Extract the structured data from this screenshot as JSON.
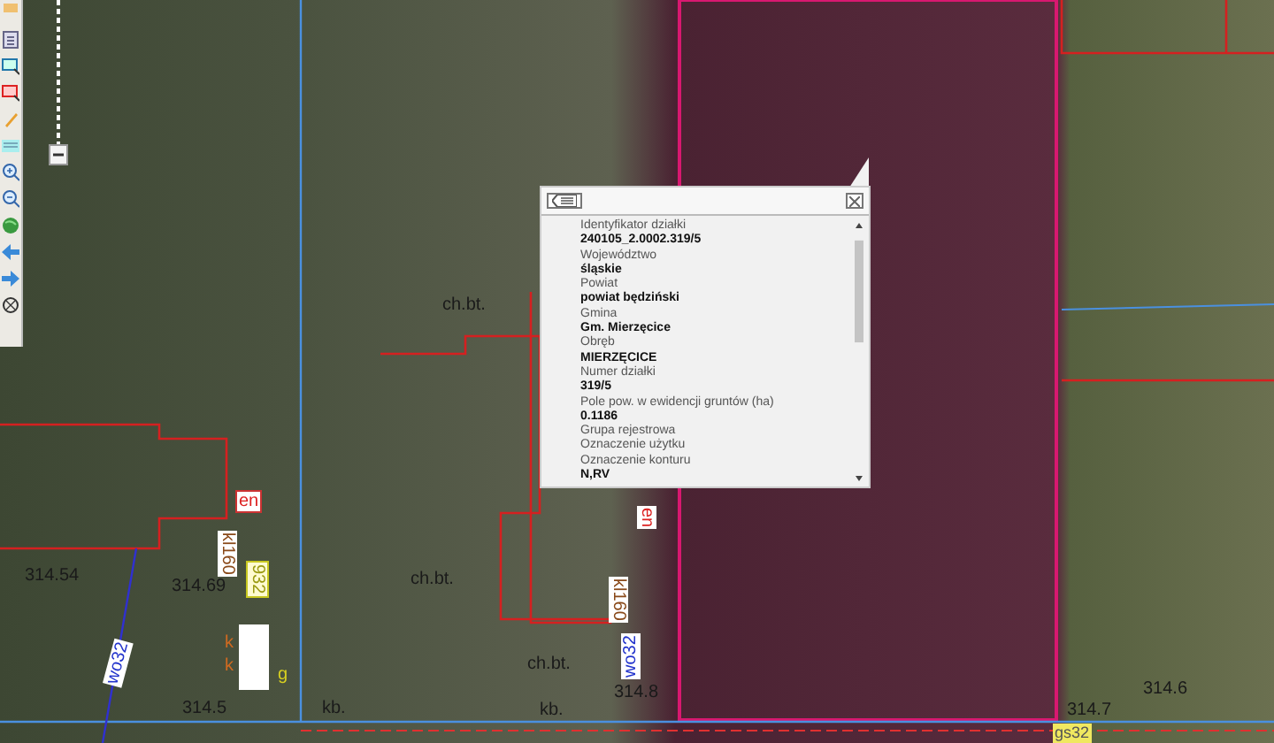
{
  "map_labels": [
    {
      "kind": "plain",
      "text": "ch.bt."
    },
    {
      "kind": "boxed",
      "text": "en"
    },
    {
      "kind": "vertical",
      "text": "kl160"
    },
    {
      "kind": "vertical-green",
      "text": "932"
    },
    {
      "kind": "plain",
      "text": "314.54"
    },
    {
      "kind": "plain",
      "text": "314.69"
    },
    {
      "kind": "slanted",
      "text": "wo32"
    },
    {
      "kind": "orange",
      "text": "k"
    },
    {
      "kind": "orange",
      "text": "k"
    },
    {
      "kind": "yellow",
      "text": "g"
    },
    {
      "kind": "plain",
      "text": "314.5"
    },
    {
      "kind": "plain",
      "text": "kb."
    },
    {
      "kind": "plain",
      "text": "ch.bt."
    },
    {
      "kind": "plain",
      "text": "ch.bt."
    },
    {
      "kind": "vertical",
      "text": "kl160"
    },
    {
      "kind": "vertical-blue",
      "text": "wo32"
    },
    {
      "kind": "plain",
      "text": "314.8"
    },
    {
      "kind": "plain",
      "text": "kb."
    },
    {
      "kind": "vertical-red",
      "text": "en"
    },
    {
      "kind": "plain",
      "text": "314.6"
    },
    {
      "kind": "plain",
      "text": "314.7"
    },
    {
      "kind": "yellow-box",
      "text": "gs32"
    }
  ],
  "popup": {
    "rows": [
      {
        "kind": "label",
        "text": "Identyfikator działki"
      },
      {
        "kind": "value",
        "text": "240105_2.0002.319/5"
      },
      {
        "kind": "label",
        "text": "Województwo"
      },
      {
        "kind": "value",
        "text": "śląskie"
      },
      {
        "kind": "label",
        "text": "Powiat"
      },
      {
        "kind": "value",
        "text": "powiat będziński"
      },
      {
        "kind": "label",
        "text": "Gmina"
      },
      {
        "kind": "value",
        "text": "Gm. Mierzęcice"
      },
      {
        "kind": "label",
        "text": "Obręb"
      },
      {
        "kind": "value",
        "text": "MIERZĘCICE"
      },
      {
        "kind": "label",
        "text": "Numer działki"
      },
      {
        "kind": "value",
        "text": "319/5"
      },
      {
        "kind": "label",
        "text": "Pole pow. w ewidencji gruntów (ha)"
      },
      {
        "kind": "value",
        "text": "0.1186"
      },
      {
        "kind": "label",
        "text": "Grupa rejestrowa"
      },
      {
        "kind": "label",
        "text": "Oznaczenie użytku"
      },
      {
        "kind": "label",
        "text": "Oznaczenie konturu"
      },
      {
        "kind": "value",
        "text": "N,RV"
      }
    ]
  }
}
